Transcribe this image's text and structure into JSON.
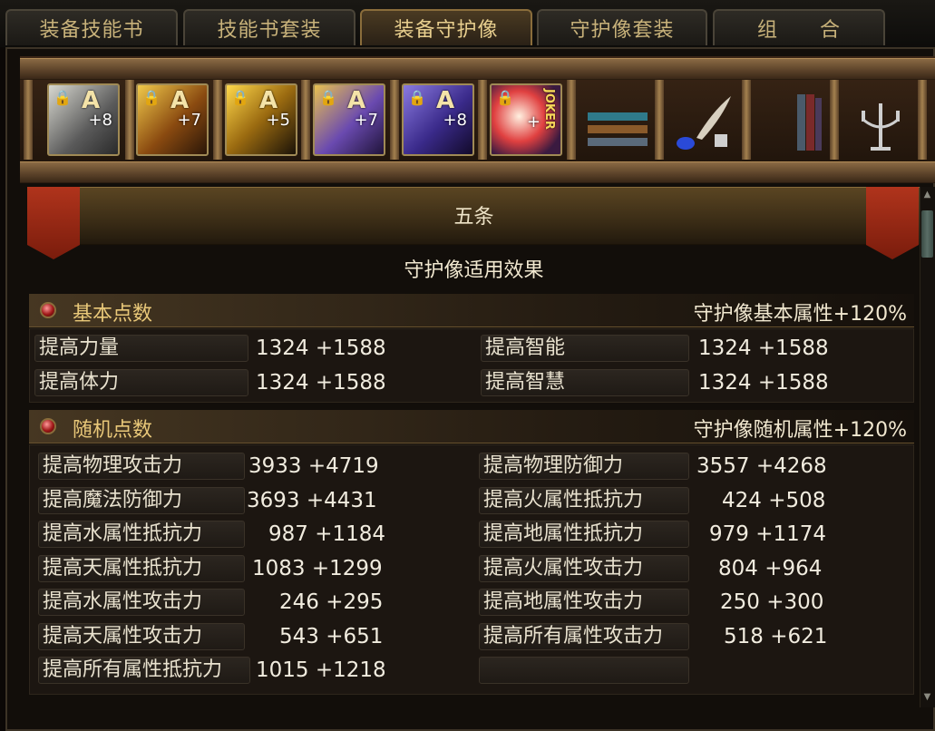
{
  "tabs": [
    {
      "label": "装备技能书"
    },
    {
      "label": "技能书套装"
    },
    {
      "label": "装备守护像"
    },
    {
      "label": "守护像套装"
    },
    {
      "label": "组　　合"
    }
  ],
  "active_tab": 2,
  "shelf": {
    "slots": [
      {
        "grade": "A",
        "plus": "+8",
        "locked": true,
        "palette": "pale"
      },
      {
        "grade": "A",
        "plus": "+7",
        "locked": true,
        "palette": "gold"
      },
      {
        "grade": "A",
        "plus": "+5",
        "locked": true,
        "palette": "gold"
      },
      {
        "grade": "A",
        "plus": "+7",
        "locked": true,
        "palette": "violet"
      },
      {
        "grade": "A",
        "plus": "+8",
        "locked": true,
        "palette": "violet"
      },
      {
        "grade": "JOKER",
        "plus": "+",
        "locked": true,
        "palette": "joker"
      }
    ],
    "decorations": [
      "books-icon",
      "quill-ink-icon",
      "book-stack-icon",
      "candelabra-icon"
    ]
  },
  "set_title": "五条",
  "subtitle": "守护像适用效果",
  "basic": {
    "title": "基本点数",
    "bonus": "守护像基本属性+120%",
    "left": [
      {
        "label": "提高力量",
        "value": "1324 +1588"
      },
      {
        "label": "提高体力",
        "value": "1324 +1588"
      }
    ],
    "right": [
      {
        "label": "提高智能",
        "value": "1324 +1588"
      },
      {
        "label": "提高智慧",
        "value": "1324 +1588"
      }
    ]
  },
  "random": {
    "title": "随机点数",
    "bonus": "守护像随机属性+120%",
    "left": [
      {
        "label": "提高物理攻击力",
        "value": "3933 +4719"
      },
      {
        "label": "提高魔法防御力",
        "value": "3693 +4431"
      },
      {
        "label": "提高水属性抵抗力",
        "value": "987 +1184"
      },
      {
        "label": "提高天属性抵抗力",
        "value": "1083 +1299"
      },
      {
        "label": "提高水属性攻击力",
        "value": "246 +295"
      },
      {
        "label": "提高天属性攻击力",
        "value": "543 +651"
      },
      {
        "label": "提高所有属性抵抗力",
        "value": "1015 +1218"
      }
    ],
    "right": [
      {
        "label": "提高物理防御力",
        "value": "3557 +4268"
      },
      {
        "label": "提高火属性抵抗力",
        "value": "424 +508"
      },
      {
        "label": "提高地属性抵抗力",
        "value": "979 +1174"
      },
      {
        "label": "提高火属性攻击力",
        "value": "804 +964"
      },
      {
        "label": "提高地属性攻击力",
        "value": "250 +300"
      },
      {
        "label": "提高所有属性攻击力",
        "value": "518 +621"
      },
      {
        "label": "",
        "value": ""
      }
    ]
  },
  "colors": {
    "accent_gold": "#e9c879",
    "lock_red": "#e03020",
    "text_light": "#f1e8d0"
  }
}
